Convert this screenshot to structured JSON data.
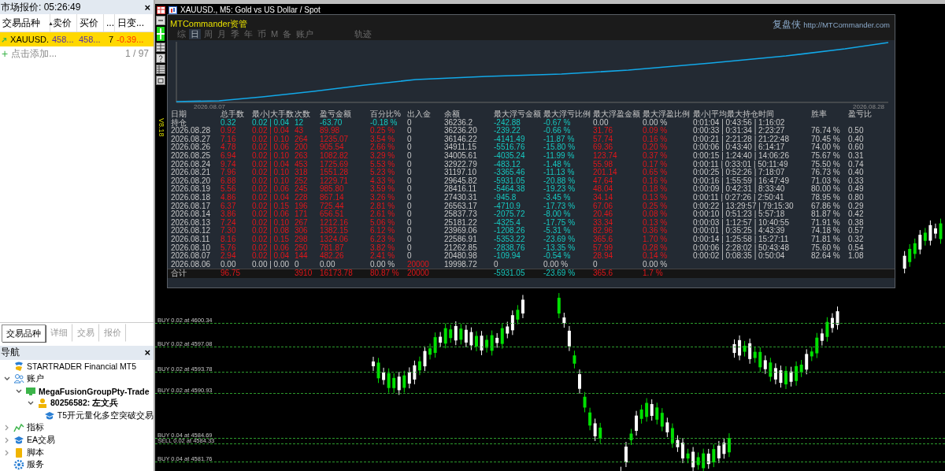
{
  "market_watch": {
    "title": "市场报价: 05:26:49",
    "close": "×",
    "columns": [
      "交易品种",
      "卖价",
      "买价",
      "...",
      "日变..."
    ],
    "sort_mark": "▲",
    "rows": [
      {
        "symbol": "XAUUSD.",
        "bid": "458...",
        "ask": "458...",
        "column_4": "7",
        "daily_change": "-0.39...",
        "selected": true
      }
    ],
    "add_row": {
      "icon": "+",
      "label": "点击添加...",
      "count": "1 / 97"
    },
    "tabs": [
      {
        "label": "交易品种",
        "selected": true
      },
      {
        "label": "详细",
        "selected": false
      },
      {
        "label": "交易",
        "selected": false
      },
      {
        "label": "报价",
        "selected": false
      }
    ]
  },
  "navigator": {
    "title": "导航",
    "close": "×",
    "tree": [
      {
        "kind": "broker",
        "label": "STARTRADER Financial MT5"
      },
      {
        "kind": "accounts",
        "label": "账户",
        "expanded": true,
        "children": [
          {
            "kind": "server",
            "label": "MegaFusionGroupPty-Trade",
            "expanded": true,
            "children": [
              {
                "kind": "account",
                "label": "80256582: 左文兵",
                "expanded": true,
                "children": [
                  {
                    "kind": "expert",
                    "label": "T5开元量化多空突破交易"
                  }
                ]
              }
            ]
          }
        ]
      },
      {
        "kind": "indicators",
        "label": "指标",
        "expanded": false
      },
      {
        "kind": "experts",
        "label": "EA交易",
        "expanded": false
      },
      {
        "kind": "scripts",
        "label": "脚本",
        "expanded": false
      },
      {
        "kind": "services",
        "label": "服务"
      }
    ]
  },
  "chart_window": {
    "title": "XAUUSD., M5:  Gold vs US Dollar / Spot",
    "version": "V8.18",
    "order_lines": [
      "BUY 0.02 at 4600.34",
      "BUY 0.02 at 4597.08",
      "BUY 0.02 at 4593.78",
      "BUY 0.02 at 4590.93",
      "BUY 0.04 at 4584.69",
      "SELL 0.02 at 4584.33",
      "BUY 0.04 at 4581.76"
    ]
  },
  "commander": {
    "title": "MTCommander资管",
    "brand": "复盘侠",
    "link": "http://MTCommander.com",
    "tabs": [
      {
        "label": "综",
        "selected": false
      },
      {
        "label": "日",
        "selected": true
      },
      {
        "label": "周",
        "selected": false
      },
      {
        "label": "月",
        "selected": false
      },
      {
        "label": "季",
        "selected": false
      },
      {
        "label": "年",
        "selected": false
      },
      {
        "label": "币",
        "selected": false
      },
      {
        "label": "M",
        "selected": false
      },
      {
        "label": "备",
        "selected": false
      },
      {
        "label": "账户",
        "selected": false
      },
      {
        "label": "轨迹",
        "selected": false
      }
    ],
    "equity_chart": {
      "start_label": "2026.08.07",
      "end_label": "2026.08.28"
    },
    "table": {
      "columns": [
        "日期",
        "总手数",
        "最小|大手数",
        "次数",
        "盈亏金额",
        "百分比%",
        "出入金",
        "余额",
        "最大浮亏金额",
        "最大浮亏比例",
        "最大浮盈金额",
        "最大浮盈比例",
        "最小|平均最大持仓时间",
        "胜率",
        "盈亏比"
      ],
      "rows": [
        {
          "kind": "position",
          "cells": [
            "持仓",
            "0.32",
            "0.02 | 0.04",
            "12",
            "-63.70",
            "-0.18 %",
            "0",
            "36236.2",
            "-242.88",
            "-0.67 %",
            "0.00",
            "0.00 %",
            "0:01:04 | 0:43:56 | 1:16:02",
            null,
            null
          ]
        },
        {
          "kind": "day",
          "cells": [
            "2026.08.28",
            "0.92",
            "0.02 | 0.04",
            "43",
            "89.98",
            "0.25 %",
            "0",
            "36236.20",
            "-239.22",
            "-0.66 %",
            "31.76",
            "0.09 %",
            "0:00:33 | 0:31:34 | 2:23:27",
            "76.74 %",
            "0.50"
          ]
        },
        {
          "kind": "day",
          "cells": [
            "2026.08.27",
            "7.16",
            "0.02 | 0.10",
            "264",
            "1235.07",
            "3.54 %",
            "0",
            "36146.22",
            "-4141.49",
            "-11.87 %",
            "57.74",
            "0.16 %",
            "0:00:21 | 2:21:28 | 21:22:48",
            "70.45 %",
            "0.40"
          ]
        },
        {
          "kind": "day",
          "cells": [
            "2026.08.26",
            "4.78",
            "0.02 | 0.06",
            "200",
            "905.54",
            "2.66 %",
            "0",
            "34911.15",
            "-5516.76",
            "-15.80 %",
            "69.36",
            "0.20 %",
            "0:00:06 | 0:43:40 | 6:14:17",
            "74.00 %",
            "0.60"
          ]
        },
        {
          "kind": "day",
          "cells": [
            "2026.08.25",
            "6.94",
            "0.02 | 0.10",
            "263",
            "1082.82",
            "3.29 %",
            "0",
            "34005.61",
            "-4035.24",
            "-11.99 %",
            "123.74",
            "0.37 %",
            "0:00:15 | 1:24:40 | 14:06:26",
            "75.67 %",
            "0.31"
          ]
        },
        {
          "kind": "day",
          "cells": [
            "2026.08.24",
            "9.74",
            "0.02 | 0.04",
            "453",
            "1725.69",
            "5.53 %",
            "0",
            "32922.79",
            "-483.12",
            "-1.48 %",
            "55.98",
            "0.17 %",
            "0:00:11 | 0:33:01 | 50:11:49",
            "75.50 %",
            "0.74"
          ]
        },
        {
          "kind": "day",
          "cells": [
            "2026.08.21",
            "7.96",
            "0.02 | 0.10",
            "318",
            "1551.28",
            "5.23 %",
            "0",
            "31197.10",
            "-3365.46",
            "-11.13 %",
            "201.14",
            "0.65 %",
            "0:00:25 | 0:52:26 | 7:18:07",
            "76.73 %",
            "0.40"
          ]
        },
        {
          "kind": "day",
          "cells": [
            "2026.08.20",
            "6.88",
            "0.02 | 0.10",
            "252",
            "1229.71",
            "4.33 %",
            "0",
            "29645.82",
            "-5931.05",
            "-20.88 %",
            "47.64",
            "0.16 %",
            "0:00:16 | 1:55:59 | 16:47:49",
            "71.03 %",
            "0.33"
          ]
        },
        {
          "kind": "day",
          "cells": [
            "2026.08.19",
            "5.56",
            "0.02 | 0.06",
            "245",
            "985.80",
            "3.59 %",
            "0",
            "28416.11",
            "-5464.38",
            "-19.23 %",
            "48.04",
            "0.18 %",
            "0:00:09 | 0:42:31 | 8:33:40",
            "80.00 %",
            "0.49"
          ]
        },
        {
          "kind": "day",
          "cells": [
            "2026.08.18",
            "4.86",
            "0.02 | 0.04",
            "228",
            "867.14",
            "3.26 %",
            "0",
            "27430.31",
            "-945.8",
            "-3.45 %",
            "34.14",
            "0.13 %",
            "0:00:11 | 0:27:26 | 2:50:41",
            "78.95 %",
            "0.80"
          ]
        },
        {
          "kind": "day",
          "cells": [
            "2026.08.17",
            "6.37",
            "0.02 | 0.15",
            "196",
            "725.44",
            "2.81 %",
            "0",
            "26563.17",
            "-4710.9",
            "-17.73 %",
            "67.06",
            "0.25 %",
            "0:00:22 | 13:29:57 | 79:15:30",
            "67.86 %",
            "0.29"
          ]
        },
        {
          "kind": "day",
          "cells": [
            "2026.08.14",
            "3.86",
            "0.02 | 0.06",
            "171",
            "656.51",
            "2.61 %",
            "0",
            "25837.73",
            "-2075.72",
            "-8.00 %",
            "20.46",
            "0.08 %",
            "0:00:10 | 0:51:23 | 5:57:18",
            "81.87 %",
            "0.42"
          ]
        },
        {
          "kind": "day",
          "cells": [
            "2026.08.13",
            "7.24",
            "0.02 | 0.10",
            "267",
            "1212.16",
            "5.06 %",
            "0",
            "25181.22",
            "-4325.4",
            "-17.75 %",
            "33.34",
            "0.13 %",
            "0:00:03 | 1:12:57 | 10:40:55",
            "71.91 %",
            "0.38"
          ]
        },
        {
          "kind": "day",
          "cells": [
            "2026.08.12",
            "7.30",
            "0.02 | 0.08",
            "306",
            "1382.15",
            "6.12 %",
            "0",
            "23969.06",
            "-1208.26",
            "-5.31 %",
            "82.96",
            "0.36 %",
            "0:00:01 | 0:35:25 | 4:43:39",
            "74.18 %",
            "0.57"
          ]
        },
        {
          "kind": "day",
          "cells": [
            "2026.08.11",
            "8.16",
            "0.02 | 0.15",
            "298",
            "1324.06",
            "6.23 %",
            "0",
            "22586.91",
            "-5353.22",
            "-23.69 %",
            "365.6",
            "1.70 %",
            "0:00:14 | 1:25:58 | 15:27:11",
            "71.81 %",
            "0.32"
          ]
        },
        {
          "kind": "day",
          "cells": [
            "2026.08.10",
            "5.76",
            "0.02 | 0.06",
            "250",
            "781.87",
            "3.82 %",
            "0",
            "21262.85",
            "-2838.76",
            "-13.35 %",
            "57.99",
            "0.28 %",
            "0:00:06 | 2:28:02 | 50:43:48",
            "75.60 %",
            "0.54"
          ]
        },
        {
          "kind": "day",
          "cells": [
            "2026.08.07",
            "2.94",
            "0.02 | 0.04",
            "144",
            "482.26",
            "2.41 %",
            "0",
            "20480.98",
            "-109.94",
            "-0.54 %",
            "28.94",
            "0.14 %",
            "0:00:02 | 0:08:35 | 0:50:04",
            "82.64 %",
            "1.08"
          ]
        },
        {
          "kind": "deposit",
          "cells": [
            "2026.08.06",
            "0.00",
            "0.00 | 0.00",
            "0",
            "0.00",
            "0.00 %",
            "20000",
            "19998.72",
            "0",
            "0.00 %",
            "0",
            "0.00 %",
            null,
            null,
            null
          ]
        },
        {
          "kind": "total",
          "cells": [
            "合计",
            "96.75",
            null,
            "3910",
            "16173.78",
            "80.87 %",
            "20000",
            null,
            "-5931.05",
            "-23.69 %",
            "365.6",
            "1.7 %",
            null,
            null,
            null
          ]
        }
      ]
    }
  }
}
